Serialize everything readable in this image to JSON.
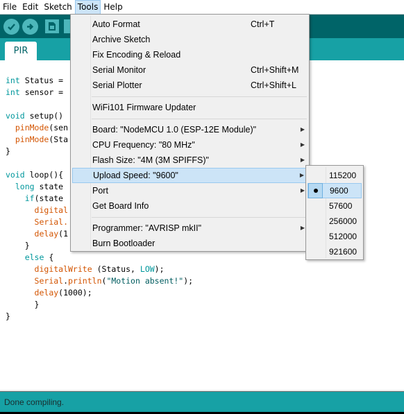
{
  "menubar": {
    "items": [
      "File",
      "Edit",
      "Sketch",
      "Tools",
      "Help"
    ],
    "active": "Tools"
  },
  "toolbar": {
    "verify_icon": "checkmark-icon",
    "upload_icon": "right-arrow-icon",
    "new_icon": "new-file-icon"
  },
  "tabs": [
    {
      "label": "PIR"
    }
  ],
  "code_lines": [
    [
      {
        "t": "int",
        "c": "kw"
      },
      {
        "t": " Status = ",
        "c": ""
      }
    ],
    [
      {
        "t": "int",
        "c": "kw"
      },
      {
        "t": " sensor = ",
        "c": ""
      }
    ],
    [],
    [
      {
        "t": "void",
        "c": "kw"
      },
      {
        "t": " setup()",
        "c": ""
      }
    ],
    [
      {
        "t": "  ",
        "c": ""
      },
      {
        "t": "pinMode",
        "c": "fn"
      },
      {
        "t": "(sen",
        "c": ""
      }
    ],
    [
      {
        "t": "  ",
        "c": ""
      },
      {
        "t": "pinMode",
        "c": "fn"
      },
      {
        "t": "(Sta",
        "c": ""
      }
    ],
    [
      {
        "t": "}",
        "c": ""
      }
    ],
    [],
    [
      {
        "t": "void",
        "c": "kw"
      },
      {
        "t": " loop(){",
        "c": ""
      }
    ],
    [
      {
        "t": "  ",
        "c": ""
      },
      {
        "t": "long",
        "c": "kw"
      },
      {
        "t": " state",
        "c": ""
      }
    ],
    [
      {
        "t": "    ",
        "c": ""
      },
      {
        "t": "if",
        "c": "kw"
      },
      {
        "t": "(state",
        "c": ""
      }
    ],
    [
      {
        "t": "      ",
        "c": ""
      },
      {
        "t": "digital",
        "c": "fn"
      }
    ],
    [
      {
        "t": "      ",
        "c": ""
      },
      {
        "t": "Serial.",
        "c": "fn"
      }
    ],
    [
      {
        "t": "      ",
        "c": ""
      },
      {
        "t": "delay",
        "c": "fn"
      },
      {
        "t": "(1",
        "c": ""
      }
    ],
    [
      {
        "t": "    }",
        "c": ""
      }
    ],
    [
      {
        "t": "    ",
        "c": ""
      },
      {
        "t": "else",
        "c": "kw"
      },
      {
        "t": " {",
        "c": ""
      }
    ],
    [
      {
        "t": "      ",
        "c": ""
      },
      {
        "t": "digitalWrite",
        "c": "fn"
      },
      {
        "t": " (Status, ",
        "c": ""
      },
      {
        "t": "LOW",
        "c": "kw"
      },
      {
        "t": ");",
        "c": ""
      }
    ],
    [
      {
        "t": "      ",
        "c": ""
      },
      {
        "t": "Serial",
        "c": "fn"
      },
      {
        "t": ".",
        "c": ""
      },
      {
        "t": "println",
        "c": "fn"
      },
      {
        "t": "(",
        "c": ""
      },
      {
        "t": "\"Motion absent!\"",
        "c": "str"
      },
      {
        "t": ");",
        "c": ""
      }
    ],
    [
      {
        "t": "      ",
        "c": ""
      },
      {
        "t": "delay",
        "c": "fn"
      },
      {
        "t": "(1000);",
        "c": ""
      }
    ],
    [
      {
        "t": "      }",
        "c": ""
      }
    ],
    [
      {
        "t": "}",
        "c": ""
      }
    ]
  ],
  "tools_menu": {
    "items": [
      {
        "label": "Auto Format",
        "shortcut": "Ctrl+T",
        "submenu": false
      },
      {
        "label": "Archive Sketch",
        "shortcut": "",
        "submenu": false
      },
      {
        "label": "Fix Encoding & Reload",
        "shortcut": "",
        "submenu": false
      },
      {
        "label": "Serial Monitor",
        "shortcut": "Ctrl+Shift+M",
        "submenu": false
      },
      {
        "label": "Serial Plotter",
        "shortcut": "Ctrl+Shift+L",
        "submenu": false
      },
      {
        "separator": true
      },
      {
        "label": "WiFi101 Firmware Updater",
        "shortcut": "",
        "submenu": false
      },
      {
        "separator": true
      },
      {
        "label": "Board: \"NodeMCU 1.0 (ESP-12E Module)\"",
        "shortcut": "",
        "submenu": true
      },
      {
        "label": "CPU Frequency: \"80 MHz\"",
        "shortcut": "",
        "submenu": true
      },
      {
        "label": "Flash Size: \"4M (3M SPIFFS)\"",
        "shortcut": "",
        "submenu": true
      },
      {
        "label": "Upload Speed: \"9600\"",
        "shortcut": "",
        "submenu": true,
        "highlighted": true
      },
      {
        "label": "Port",
        "shortcut": "",
        "submenu": true
      },
      {
        "label": "Get Board Info",
        "shortcut": "",
        "submenu": false
      },
      {
        "separator": true
      },
      {
        "label": "Programmer: \"AVRISP mkII\"",
        "shortcut": "",
        "submenu": true
      },
      {
        "label": "Burn Bootloader",
        "shortcut": "",
        "submenu": false
      }
    ]
  },
  "upload_speed_submenu": {
    "options": [
      "115200",
      "9600",
      "57600",
      "256000",
      "512000",
      "921600"
    ],
    "selected": "9600"
  },
  "status": {
    "message": "Done compiling."
  },
  "colors": {
    "toolbar": "#006468",
    "tabstrip": "#17a1a5",
    "keyword": "#00979c",
    "function": "#d35400",
    "highlight": "#cce4f7"
  }
}
